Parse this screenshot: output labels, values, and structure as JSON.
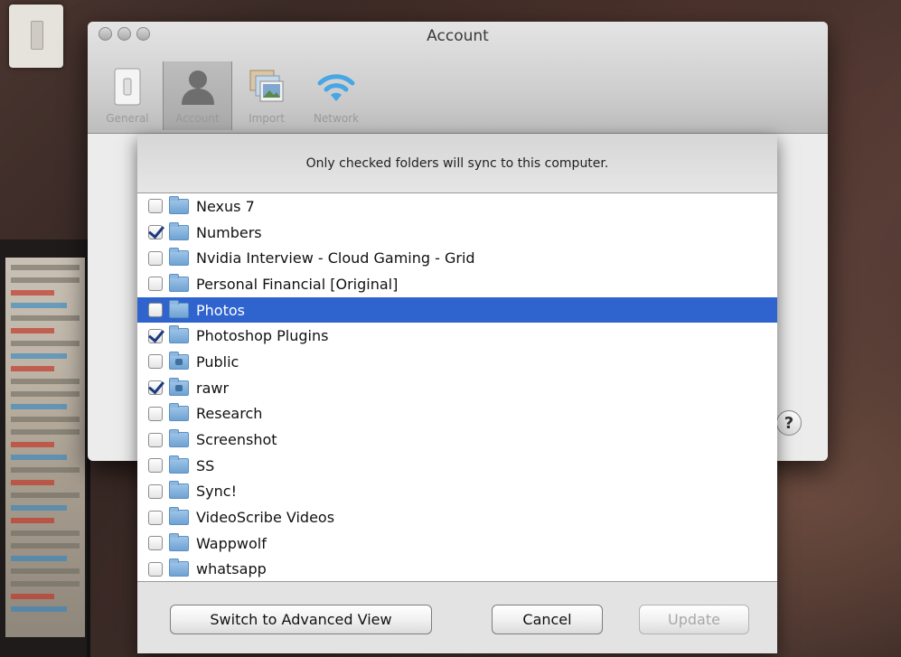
{
  "window": {
    "title": "Account",
    "toolbar": [
      {
        "label": "General",
        "icon": "light-switch-icon",
        "active": false
      },
      {
        "label": "Account",
        "icon": "user-icon",
        "active": true
      },
      {
        "label": "Import",
        "icon": "photos-icon",
        "active": false
      },
      {
        "label": "Network",
        "icon": "wifi-icon",
        "active": false
      }
    ],
    "help_label": "?"
  },
  "sheet": {
    "message": "Only checked folders will sync to this computer.",
    "folders": [
      {
        "name": "Nexus 7",
        "checked": false,
        "selected": false
      },
      {
        "name": "Numbers",
        "checked": true,
        "selected": false
      },
      {
        "name": "Nvidia Interview - Cloud Gaming - Grid",
        "checked": false,
        "selected": false
      },
      {
        "name": "Personal Financial [Original]",
        "checked": false,
        "selected": false
      },
      {
        "name": "Photos",
        "checked": false,
        "selected": true
      },
      {
        "name": "Photoshop Plugins",
        "checked": true,
        "selected": false
      },
      {
        "name": "Public",
        "checked": false,
        "selected": false,
        "special": true
      },
      {
        "name": "rawr",
        "checked": true,
        "selected": false,
        "special": true
      },
      {
        "name": "Research",
        "checked": false,
        "selected": false
      },
      {
        "name": "Screenshot",
        "checked": false,
        "selected": false
      },
      {
        "name": "SS",
        "checked": false,
        "selected": false
      },
      {
        "name": "Sync!",
        "checked": false,
        "selected": false
      },
      {
        "name": "VideoScribe Videos",
        "checked": false,
        "selected": false
      },
      {
        "name": "Wappwolf",
        "checked": false,
        "selected": false
      },
      {
        "name": "whatsapp",
        "checked": false,
        "selected": false
      }
    ],
    "buttons": {
      "advanced": "Switch to Advanced View",
      "cancel": "Cancel",
      "update": "Update"
    }
  },
  "colors": {
    "selection": "#2f64cf",
    "checkmark": "#1d3a80",
    "folder": "#8db7de"
  }
}
